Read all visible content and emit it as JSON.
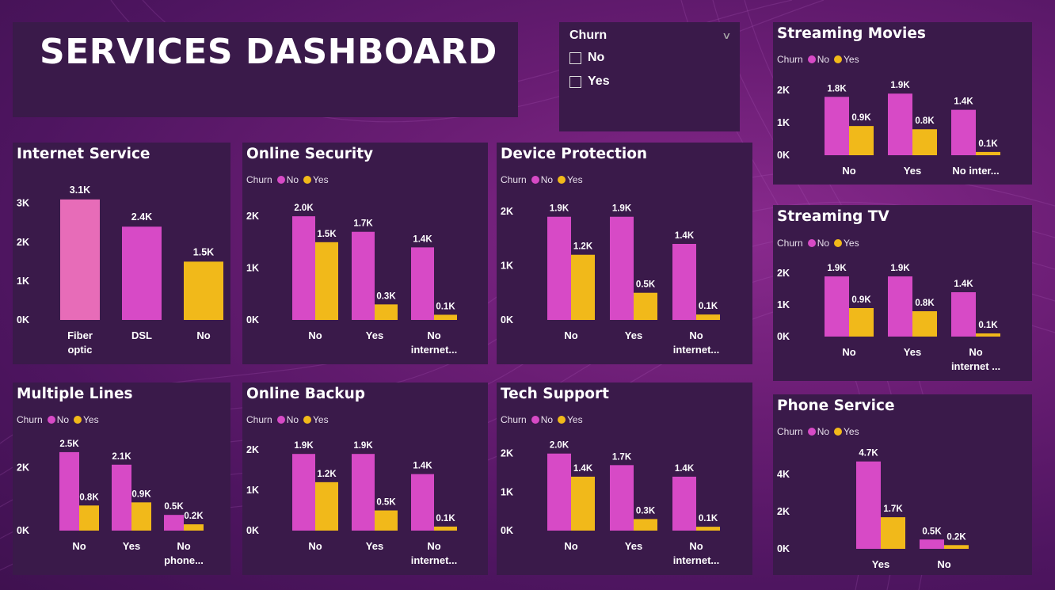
{
  "title": "SERVICES DASHBOARD",
  "colors": {
    "no": "#d74ac6",
    "yes": "#f1b91a",
    "fiber": "#e76cb8"
  },
  "slicer": {
    "title": "Churn",
    "options": [
      "No",
      "Yes"
    ]
  },
  "legend": {
    "title": "Churn",
    "no": "No",
    "yes": "Yes"
  },
  "charts": {
    "internet": {
      "title": "Internet Service",
      "chart_data": {
        "type": "bar",
        "categories": [
          [
            "Fiber",
            "optic"
          ],
          [
            "DSL"
          ],
          [
            "No"
          ]
        ],
        "values": [
          3.1,
          2.4,
          1.5
        ],
        "labels": [
          "3.1K",
          "2.4K",
          "1.5K"
        ],
        "yticks": [
          "0K",
          "1K",
          "2K",
          "3K"
        ],
        "ylim": [
          0,
          3.3
        ]
      }
    },
    "security": {
      "title": "Online Security",
      "chart_data": {
        "type": "bar",
        "categories": [
          [
            "No"
          ],
          [
            "Yes"
          ],
          [
            "No",
            "internet..."
          ]
        ],
        "series": [
          {
            "name": "No",
            "values": [
              2.0,
              1.7,
              1.4
            ],
            "labels": [
              "2.0K",
              "1.7K",
              "1.4K"
            ]
          },
          {
            "name": "Yes",
            "values": [
              1.5,
              0.3,
              0.1
            ],
            "labels": [
              "1.5K",
              "0.3K",
              "0.1K"
            ]
          }
        ],
        "yticks": [
          "0K",
          "1K",
          "2K"
        ],
        "ylim": [
          0,
          2.2
        ]
      }
    },
    "device": {
      "title": "Device Protection",
      "chart_data": {
        "type": "bar",
        "categories": [
          [
            "No"
          ],
          [
            "Yes"
          ],
          [
            "No",
            "internet..."
          ]
        ],
        "series": [
          {
            "name": "No",
            "values": [
              1.9,
              1.9,
              1.4
            ],
            "labels": [
              "1.9K",
              "1.9K",
              "1.4K"
            ]
          },
          {
            "name": "Yes",
            "values": [
              1.2,
              0.5,
              0.1
            ],
            "labels": [
              "1.2K",
              "0.5K",
              "0.1K"
            ]
          }
        ],
        "yticks": [
          "0K",
          "1K",
          "2K"
        ],
        "ylim": [
          0,
          2.1
        ]
      }
    },
    "movies": {
      "title": "Streaming Movies",
      "chart_data": {
        "type": "bar",
        "categories": [
          [
            "No"
          ],
          [
            "Yes"
          ],
          [
            "No inter..."
          ]
        ],
        "series": [
          {
            "name": "No",
            "values": [
              1.8,
              1.9,
              1.4
            ],
            "labels": [
              "1.8K",
              "1.9K",
              "1.4K"
            ]
          },
          {
            "name": "Yes",
            "values": [
              0.9,
              0.8,
              0.1
            ],
            "labels": [
              "0.9K",
              "0.8K",
              "0.1K"
            ]
          }
        ],
        "yticks": [
          "0K",
          "1K",
          "2K"
        ],
        "ylim": [
          0,
          2.1
        ]
      }
    },
    "tv": {
      "title": "Streaming TV",
      "chart_data": {
        "type": "bar",
        "categories": [
          [
            "No"
          ],
          [
            "Yes"
          ],
          [
            "No",
            "internet ..."
          ]
        ],
        "series": [
          {
            "name": "No",
            "values": [
              1.9,
              1.9,
              1.4
            ],
            "labels": [
              "1.9K",
              "1.9K",
              "1.4K"
            ]
          },
          {
            "name": "Yes",
            "values": [
              0.9,
              0.8,
              0.1
            ],
            "labels": [
              "0.9K",
              "0.8K",
              "0.1K"
            ]
          }
        ],
        "yticks": [
          "0K",
          "1K",
          "2K"
        ],
        "ylim": [
          0,
          2.1
        ]
      }
    },
    "lines": {
      "title": "Multiple Lines",
      "chart_data": {
        "type": "bar",
        "categories": [
          [
            "No"
          ],
          [
            "Yes"
          ],
          [
            "No",
            "phone..."
          ]
        ],
        "series": [
          {
            "name": "No",
            "values": [
              2.5,
              2.1,
              0.5
            ],
            "labels": [
              "2.5K",
              "2.1K",
              "0.5K"
            ]
          },
          {
            "name": "Yes",
            "values": [
              0.8,
              0.9,
              0.2
            ],
            "labels": [
              "0.8K",
              "0.9K",
              "0.2K"
            ]
          }
        ],
        "yticks": [
          "0K",
          "2K"
        ],
        "ylim": [
          0,
          2.7
        ]
      }
    },
    "backup": {
      "title": "Online Backup",
      "chart_data": {
        "type": "bar",
        "categories": [
          [
            "No"
          ],
          [
            "Yes"
          ],
          [
            "No",
            "internet..."
          ]
        ],
        "series": [
          {
            "name": "No",
            "values": [
              1.9,
              1.9,
              1.4
            ],
            "labels": [
              "1.9K",
              "1.9K",
              "1.4K"
            ]
          },
          {
            "name": "Yes",
            "values": [
              1.2,
              0.5,
              0.1
            ],
            "labels": [
              "1.2K",
              "0.5K",
              "0.1K"
            ]
          }
        ],
        "yticks": [
          "0K",
          "1K",
          "2K"
        ],
        "ylim": [
          0,
          2.1
        ]
      }
    },
    "support": {
      "title": "Tech Support",
      "chart_data": {
        "type": "bar",
        "categories": [
          [
            "No"
          ],
          [
            "Yes"
          ],
          [
            "No",
            "internet..."
          ]
        ],
        "series": [
          {
            "name": "No",
            "values": [
              2.0,
              1.7,
              1.4
            ],
            "labels": [
              "2.0K",
              "1.7K",
              "1.4K"
            ]
          },
          {
            "name": "Yes",
            "values": [
              1.4,
              0.3,
              0.1
            ],
            "labels": [
              "1.4K",
              "0.3K",
              "0.1K"
            ]
          }
        ],
        "yticks": [
          "0K",
          "1K",
          "2K"
        ],
        "ylim": [
          0,
          2.2
        ]
      }
    },
    "phone": {
      "title": "Phone Service",
      "chart_data": {
        "type": "bar",
        "categories": [
          [
            "Yes"
          ],
          [
            "No"
          ]
        ],
        "series": [
          {
            "name": "No",
            "values": [
              4.7,
              0.5
            ],
            "labels": [
              "4.7K",
              "0.5K"
            ]
          },
          {
            "name": "Yes",
            "values": [
              1.7,
              0.2
            ],
            "labels": [
              "1.7K",
              "0.2K"
            ]
          }
        ],
        "yticks": [
          "0K",
          "2K",
          "4K"
        ],
        "ylim": [
          0,
          4.9
        ]
      }
    }
  }
}
